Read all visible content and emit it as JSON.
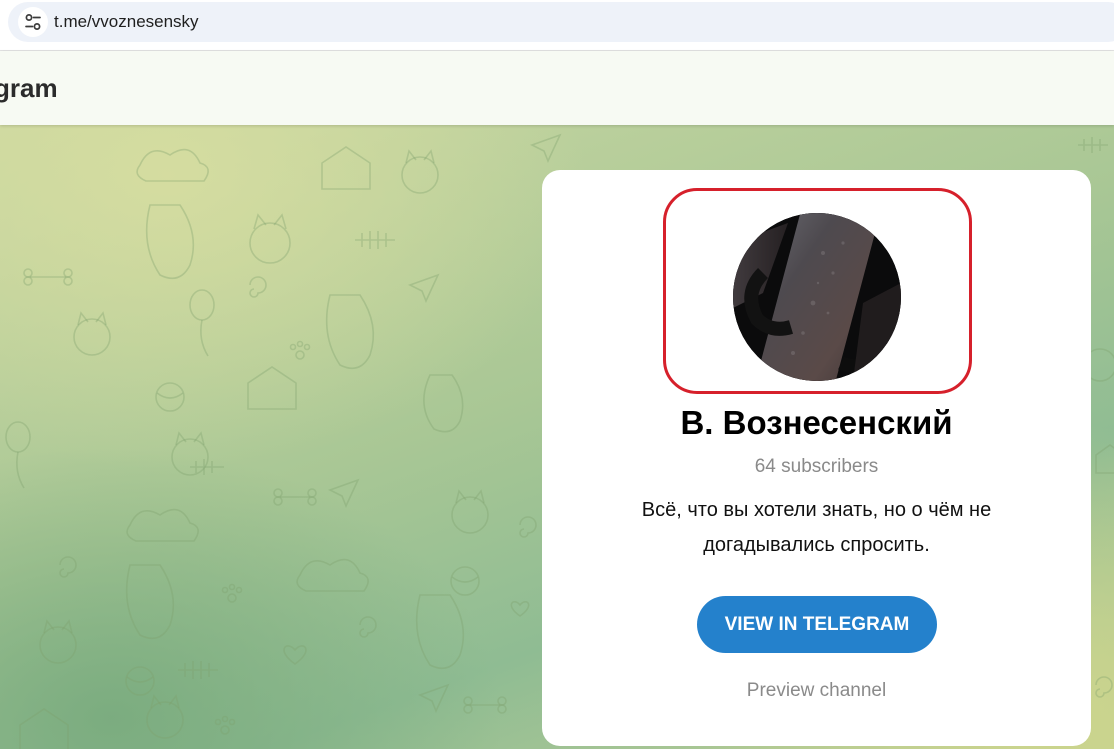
{
  "browser": {
    "url": "t.me/vvoznesensky",
    "site_icon": "tune-icon"
  },
  "header": {
    "title": "gram"
  },
  "channel": {
    "name": "В. Вознесенский",
    "subscribers": "64 subscribers",
    "description": "Всё, что вы хотели знать, но о чём не догадывались спросить.",
    "view_button": "VIEW IN TELEGRAM",
    "preview_link": "Preview channel"
  },
  "colors": {
    "accent_button": "#2481cc",
    "highlight_outline": "#d6202b"
  }
}
